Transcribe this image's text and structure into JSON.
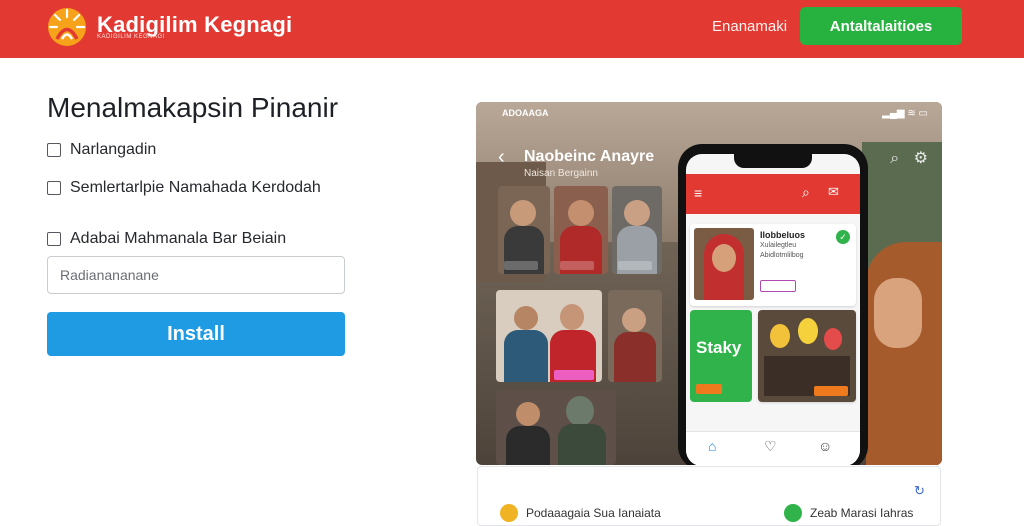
{
  "header": {
    "brand_name": "Kadigilim Kegnagi",
    "brand_tagline": "KADIGILIM KEGNAGI",
    "nav_link": "Enanamaki",
    "cta_label": "Antaltalaitioes",
    "colors": {
      "bar": "#e23a33",
      "cta": "#27b13e"
    }
  },
  "form": {
    "title": "Menalmakapsin Pinanir",
    "options": [
      {
        "label": "Narlangadin",
        "checked": false
      },
      {
        "label": "Semlertarlpie Namahada Kerdodah",
        "checked": false
      },
      {
        "label": "Adabai Mahmanala Bar Beiain",
        "checked": false
      }
    ],
    "input_placeholder": "Radianananane",
    "install_label": "Install",
    "colors": {
      "install": "#1e9be3"
    }
  },
  "promo": {
    "status_left": "ADOAAGA",
    "status_right": "▂▄▆ ≋ ▭",
    "title": "Naobeinc Anayre",
    "subtitle": "Naisan Bergainn",
    "phone": {
      "card_title": "Ilobbeluos",
      "card_lines": [
        "Xulailegtleu",
        "Abidlotmlilbog"
      ],
      "green_word": "Staky"
    }
  },
  "bottom": {
    "left_text": "Podaaagaia Sua Ianaiata",
    "right_text": "Zeab Marasi Iahras"
  },
  "icons": {
    "logo": "sun-logo-icon",
    "back": "back-arrow-icon",
    "search": "search-icon",
    "settings": "settings-icon",
    "menu": "menu-icon",
    "message": "message-icon",
    "home": "home-icon",
    "heart": "heart-icon",
    "profile": "profile-icon",
    "refresh": "refresh-icon"
  }
}
